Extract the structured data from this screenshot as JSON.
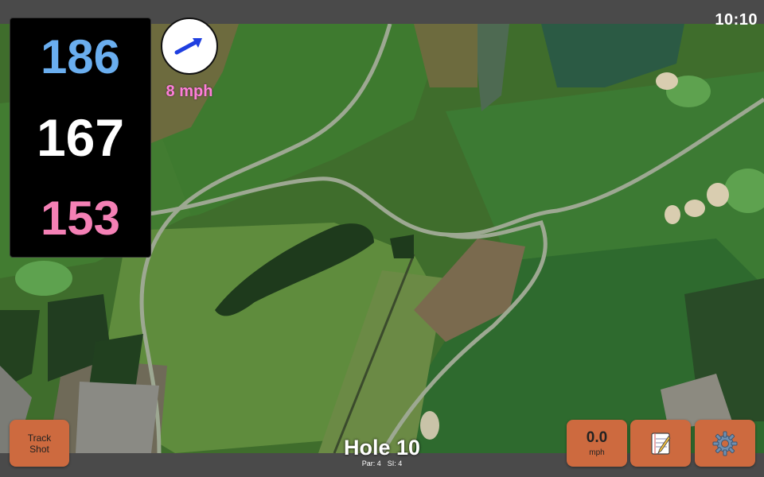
{
  "status": {
    "time": "10:10"
  },
  "distances": {
    "back": "186",
    "middle": "167",
    "front": "153"
  },
  "wind": {
    "speed": "8 mph",
    "icon": "wind-direction-arrow-icon"
  },
  "buttons": {
    "track_shot": "Track\nShot",
    "speed_value": "0.0",
    "speed_unit": "mph",
    "notes_icon": "notepad-icon",
    "settings_icon": "gear-icon"
  },
  "hole": {
    "title": "Hole 10",
    "par": "Par: 4",
    "si": "SI: 4"
  },
  "colors": {
    "back_distance": "#6aaeef",
    "middle_distance": "#ffffff",
    "front_distance": "#f480b5",
    "wind_speed": "#ff7fd8",
    "button": "#cd6a3f",
    "bar": "#4a4a4a"
  }
}
